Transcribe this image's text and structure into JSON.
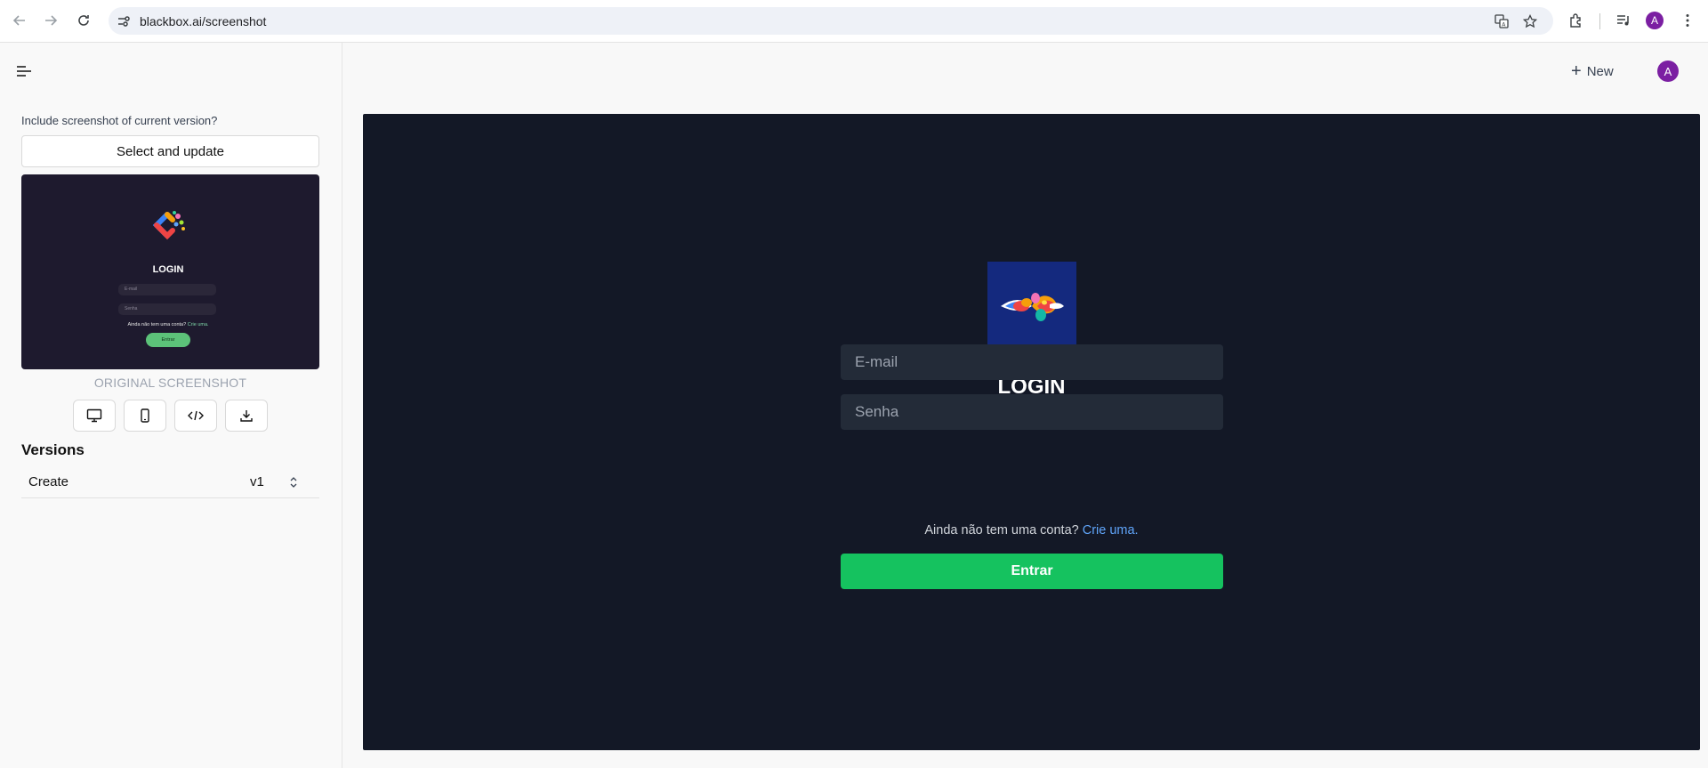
{
  "browser": {
    "url": "blackbox.ai/screenshot",
    "avatar_letter": "A",
    "accent": "#7b1fa2"
  },
  "sidebar": {
    "include_label": "Include screenshot of current version?",
    "select_button": "Select and update",
    "thumbnail": {
      "title": "LOGIN",
      "email_placeholder": "E-mail",
      "password_placeholder": "Senha",
      "signup_text": "Ainda não tem uma conta?",
      "signup_link": "Crie uma.",
      "submit": "Entrar"
    },
    "original_label": "ORIGINAL SCREENSHOT",
    "view_icons": [
      "desktop-icon",
      "mobile-icon",
      "code-icon",
      "download-icon"
    ],
    "versions_title": "Versions",
    "version": {
      "name": "Create",
      "number": "v1"
    }
  },
  "header": {
    "new_label": "New",
    "avatar_letter": "A"
  },
  "preview": {
    "title": "LOGIN",
    "email_placeholder": "E-mail",
    "password_placeholder": "Senha",
    "signup_text": "Ainda não tem uma conta?",
    "signup_link": "Crie uma.",
    "submit": "Entrar",
    "background": "#131826",
    "button_color": "#15c25f",
    "link_color": "#60a5fa"
  }
}
